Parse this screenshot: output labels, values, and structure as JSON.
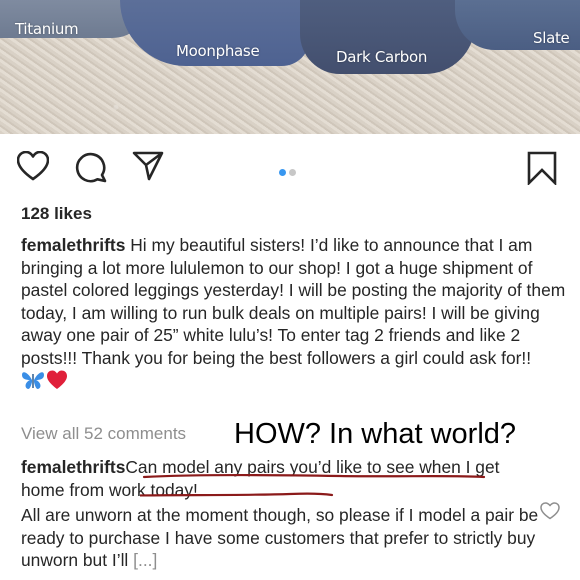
{
  "photo": {
    "labels": {
      "titanium": "Titanium",
      "moonphase": "Moonphase",
      "dark_carbon": "Dark Carbon",
      "slate": "Slate"
    }
  },
  "actions": {
    "icons": [
      "heart-icon",
      "comment-icon",
      "share-icon",
      "bookmark-icon"
    ],
    "carousel": {
      "total": 2,
      "active": 1
    }
  },
  "post": {
    "likes": "128 likes",
    "caption_user": "femalethrifts",
    "caption_text": " Hi my beautiful sisters! I’d like to announce that I am bringing a lot more lululemon to our shop! I got a huge shipment of pastel colored leggings yesterday! I will be posting the majority of them today, I am willing to run bulk deals on multiple pairs! I will be giving away one pair of 25” white lulu’s! To enter tag 2 friends and like 2 posts!!! Thank you for being the best followers a girl could ask for!!",
    "caption_emojis": [
      "butterfly",
      "red-heart"
    ],
    "view_all_comments": "View all 52 comments",
    "annotation": "HOW? In what world?",
    "comment_user": "femalethrifts",
    "comment_underlined": "Can model any pairs you’d like to see when I get home from work today!",
    "comment_body": "All are unworn at the moment though, so please if I model a pair be ready to purchase I have some customers that prefer to strictly buy unworn but I’ll",
    "comment_more": "[...]"
  },
  "colors": {
    "text": "#262626",
    "muted": "#8e8e8e",
    "carousel_active": "#3897f0",
    "carousel_inactive": "#c7c7c7",
    "underline": "#8b1a1a",
    "butterfly": "#3a8ee6",
    "heart": "#e0203a"
  }
}
